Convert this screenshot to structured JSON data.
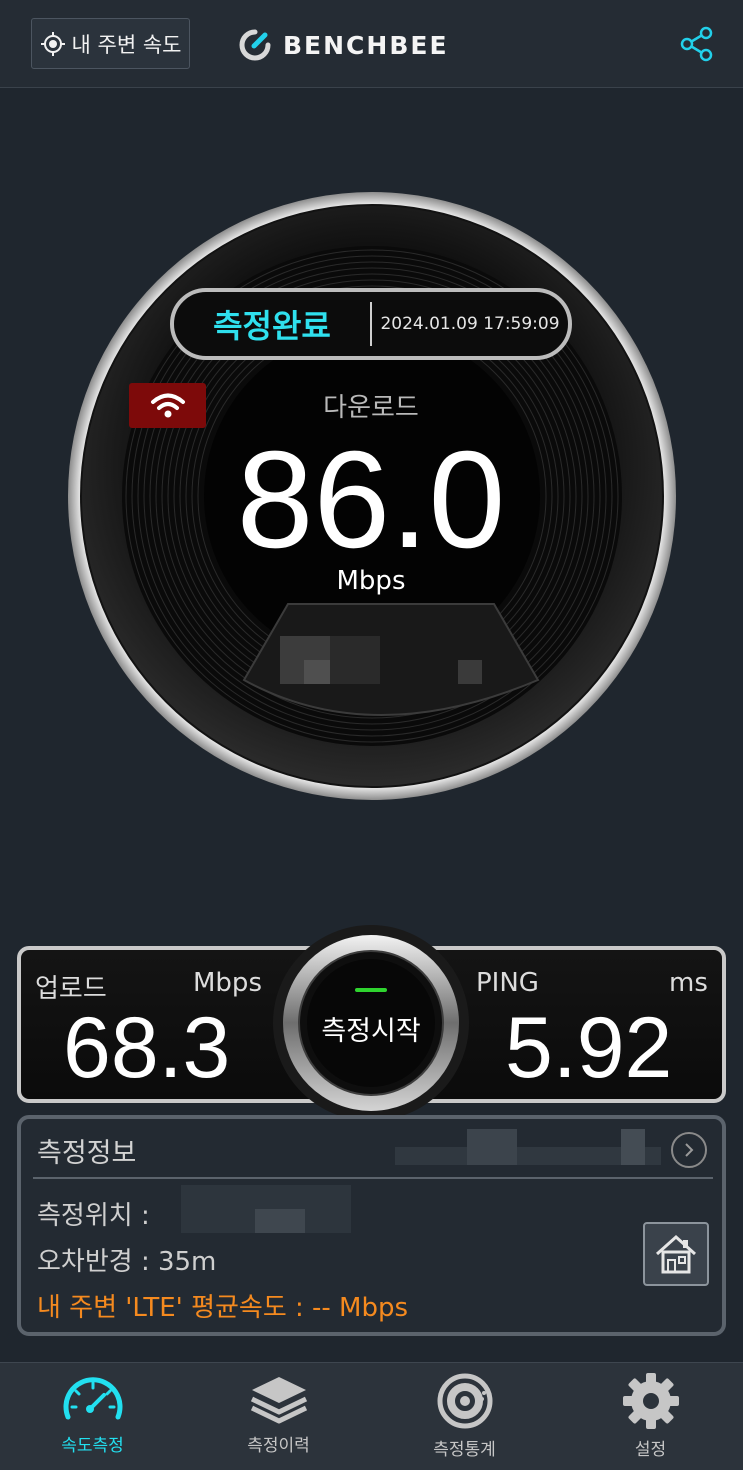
{
  "header": {
    "nearby_button_label": "내 주변 속도",
    "logo_text": "BENCHBEE",
    "icons": [
      "location-target-icon",
      "benchbee-logo-icon",
      "share-icon"
    ]
  },
  "gauge": {
    "status": "측정완료",
    "timestamp": "2024.01.09 17:59:09",
    "network_icon": "wifi-icon",
    "download_label": "다운로드",
    "download_value": "86.0",
    "download_unit": "Mbps"
  },
  "stats": {
    "upload_label": "업로드",
    "upload_unit": "Mbps",
    "upload_value": "68.3",
    "ping_label": "PING",
    "ping_unit": "ms",
    "ping_value": "5.92",
    "start_button_label": "측정시작"
  },
  "info": {
    "title": "측정정보",
    "location_label": "측정위치 :",
    "error_radius": "오차반경 : 35m",
    "lte_average": "내 주변 'LTE' 평균속도 : -- Mbps"
  },
  "nav": {
    "items": [
      {
        "label": "속도측정",
        "icon": "speedometer-icon",
        "active": true
      },
      {
        "label": "측정이력",
        "icon": "layers-icon",
        "active": false
      },
      {
        "label": "측정통계",
        "icon": "statistics-icon",
        "active": false
      },
      {
        "label": "설정",
        "icon": "gear-icon",
        "active": false
      }
    ]
  },
  "colors": {
    "accent_cyan": "#22e0f0",
    "orange_text": "#f58a1f",
    "wifi_badge": "#7d0a0a",
    "background": "#1f262e"
  }
}
